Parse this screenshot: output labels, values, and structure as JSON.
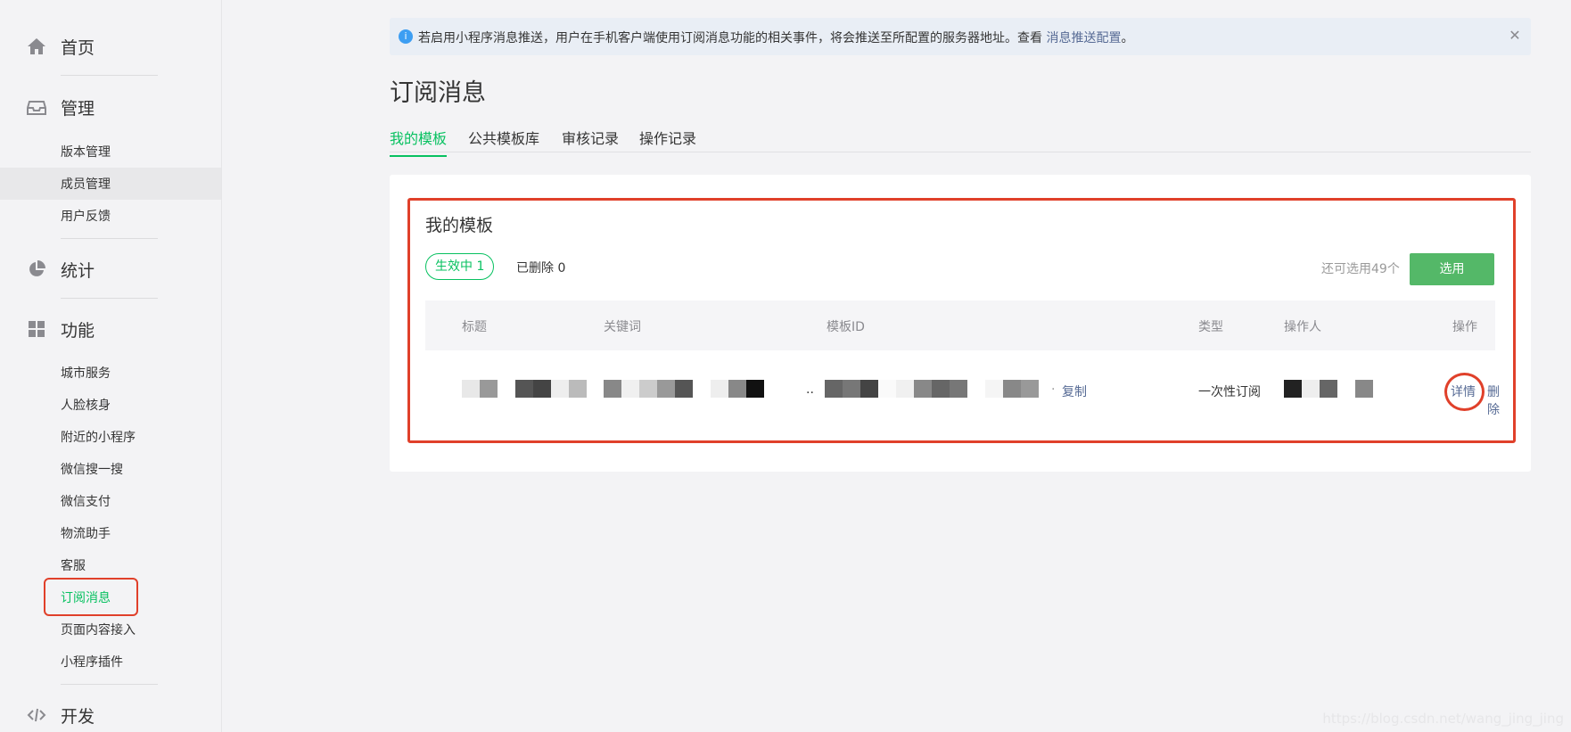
{
  "sidebar": {
    "home": "首页",
    "manage": "管理",
    "manage_items": [
      "版本管理",
      "成员管理",
      "用户反馈"
    ],
    "stats": "统计",
    "features": "功能",
    "feature_items": [
      "城市服务",
      "人脸核身",
      "附近的小程序",
      "微信搜一搜",
      "微信支付",
      "物流助手",
      "客服",
      "订阅消息",
      "页面内容接入",
      "小程序插件"
    ],
    "dev": "开发"
  },
  "notice": {
    "text": "若启用小程序消息推送，用户在手机客户端使用订阅消息功能的相关事件，将会推送至所配置的服务器地址。查看 ",
    "link": "消息推送配置",
    "suffix": "。"
  },
  "page": {
    "title": "订阅消息",
    "tabs": [
      "我的模板",
      "公共模板库",
      "审核记录",
      "操作记录"
    ]
  },
  "card": {
    "title": "我的模板",
    "active_pill": "生效中 1",
    "deleted": "已删除  0",
    "remaining": "还可选用49个",
    "select_button": "选用",
    "columns": {
      "title": "标题",
      "keywords": "关键词",
      "template_id": "模板ID",
      "type": "类型",
      "operator": "操作人",
      "action": "操作"
    },
    "row": {
      "ellipsis": "..",
      "dot": "·",
      "copy": "复制",
      "type": "一次性订阅",
      "details": "详情",
      "delete": "删除"
    }
  },
  "watermark": "https://blog.csdn.net/wang_jing_jing"
}
